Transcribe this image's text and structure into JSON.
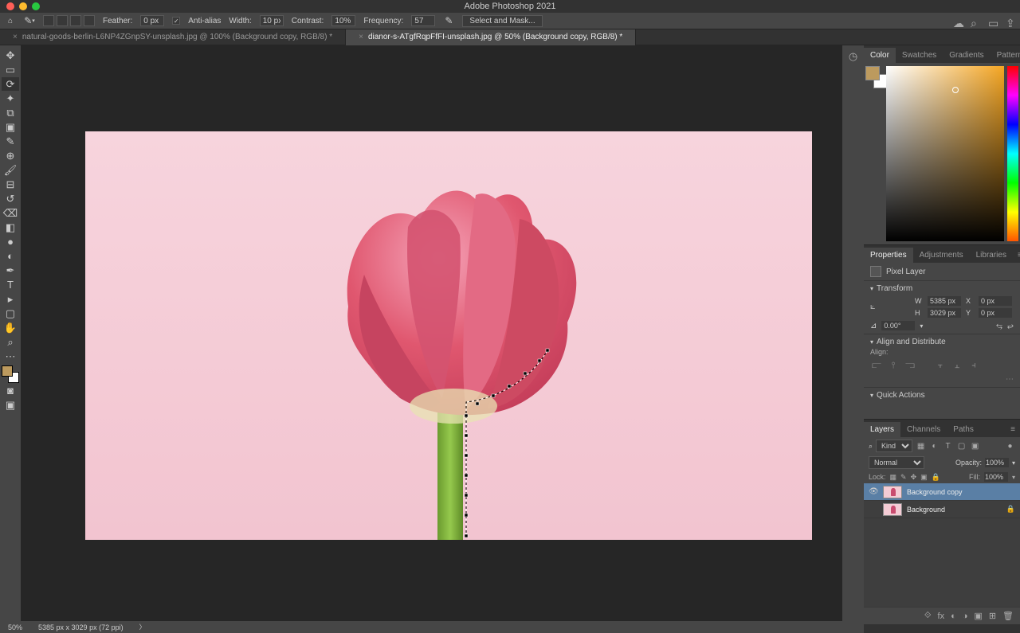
{
  "app_title": "Adobe Photoshop 2021",
  "options_bar": {
    "feather_label": "Feather:",
    "feather_value": "0 px",
    "antialias_label": "Anti-alias",
    "width_label": "Width:",
    "width_value": "10 px",
    "contrast_label": "Contrast:",
    "contrast_value": "10%",
    "frequency_label": "Frequency:",
    "frequency_value": "57",
    "select_mask": "Select and Mask..."
  },
  "tabs": [
    {
      "label": "natural-goods-berlin-L6NP4ZGnpSY-unsplash.jpg @ 100% (Background copy, RGB/8) *",
      "active": false
    },
    {
      "label": "dianor-s-ATgfRqpFfFI-unsplash.jpg @ 50% (Background copy, RGB/8) *",
      "active": true
    }
  ],
  "panels": {
    "color_tabs": [
      "Color",
      "Swatches",
      "Gradients",
      "Patterns"
    ],
    "prop_tabs": [
      "Properties",
      "Adjustments",
      "Libraries"
    ],
    "pixel_layer_label": "Pixel Layer",
    "transform_label": "Transform",
    "w": "5385 px",
    "h": "3029 px",
    "x": "0 px",
    "y": "0 px",
    "rotation": "0.00°",
    "align_label": "Align and Distribute",
    "align_sub": "Align:",
    "quick_label": "Quick Actions",
    "layers_tabs": [
      "Layers",
      "Channels",
      "Paths"
    ],
    "kind_label": "Kind",
    "blend_mode": "Normal",
    "opacity_label": "Opacity:",
    "opacity_value": "100%",
    "lock_label": "Lock:",
    "fill_label": "Fill:",
    "fill_value": "100%",
    "layers": [
      {
        "name": "Background copy",
        "visible": true,
        "selected": true,
        "locked": false
      },
      {
        "name": "Background",
        "visible": false,
        "selected": false,
        "locked": true
      }
    ]
  },
  "status": {
    "zoom": "50%",
    "dims": "5385 px x 3029 px (72 ppi)"
  }
}
